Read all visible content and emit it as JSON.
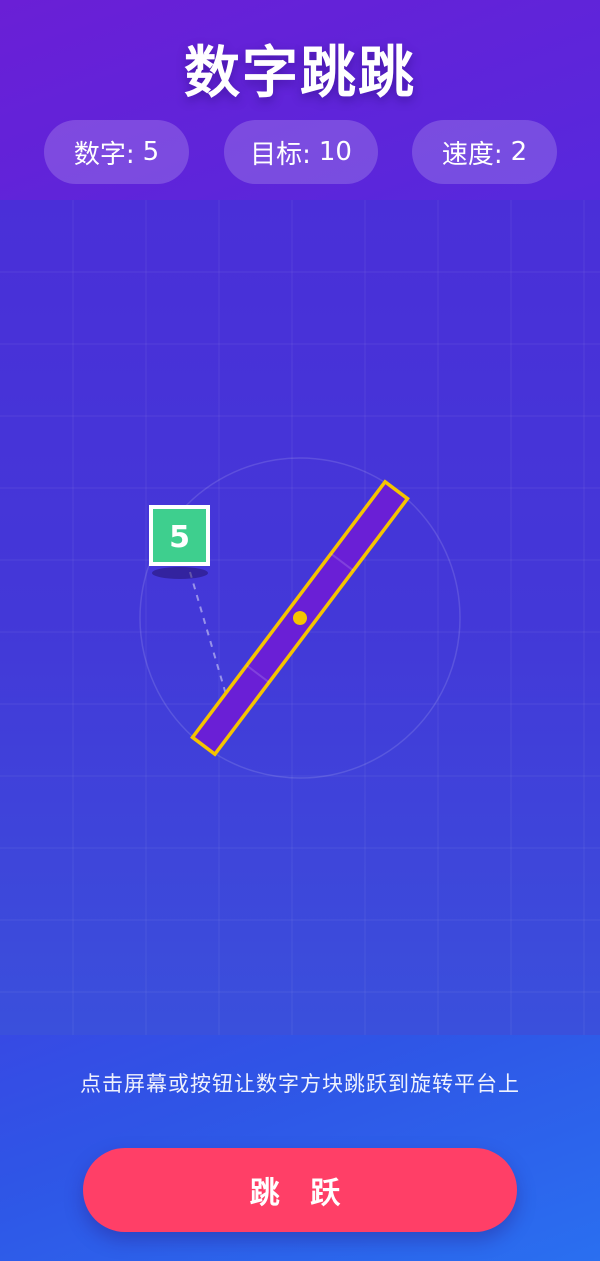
{
  "header": {
    "title": "数字跳跳",
    "stats": [
      {
        "label": "数字:",
        "value": "5"
      },
      {
        "label": "目标:",
        "value": "10"
      },
      {
        "label": "速度:",
        "value": "2"
      }
    ]
  },
  "game": {
    "number_block": "5",
    "block_color": "#3ecf8e",
    "platform_color": "#6a1fd6",
    "platform_border_color": "#f5c400"
  },
  "hint_text": "点击屏幕或按钮让数字方块跳跃到旋转平台上",
  "jump_button": {
    "label": "跳 跃",
    "color": "#ff3f67"
  }
}
